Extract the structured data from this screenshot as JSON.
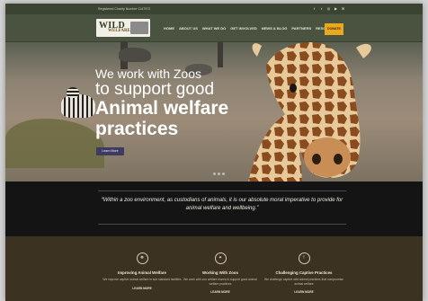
{
  "topbar": {
    "registration": "Registered Charity Number 1147972",
    "social_icons": [
      "facebook-icon",
      "twitter-icon",
      "instagram-icon",
      "youtube-icon",
      "email-icon"
    ]
  },
  "logo": {
    "main": "WILD",
    "sub": "WELFARE"
  },
  "nav": {
    "items": [
      "HOME",
      "ABOUT US",
      "WHAT WE DO",
      "GET INVOLVED",
      "NEWS & BLOG",
      "PARTNERS",
      "RESOURCES"
    ],
    "donate_label": "DONATE"
  },
  "hero": {
    "line1": "We work with Zoos",
    "line2": "to support good",
    "line3": "Animal welfare",
    "line4": "practices",
    "button_label": "Learn More"
  },
  "quote": {
    "text": "“Within a zoo environment, as custodians of animals, it is our absolute moral imperative to provide for animal welfare and wellbeing.”"
  },
  "features": [
    {
      "title": "Improving Animal Welfare",
      "desc": "We improve captive animal welfare in sub standard facilities",
      "more": "LEARN MORE",
      "icon": "paw-icon"
    },
    {
      "title": "Working With Zoos",
      "desc": "We work with zoo welfare teams to support good animal welfare practices",
      "more": "LEARN MORE",
      "icon": "handshake-icon"
    },
    {
      "title": "Challenging Captive Practices",
      "desc": "We challenge captive wild animal practices that compromise animal welfare",
      "more": "LEARN MORE",
      "icon": "alert-icon"
    }
  ],
  "colors": {
    "topbar": "#3b4331",
    "nav": "#4a5340",
    "donate": "#e9a91e",
    "learn_more": "#3d3b61",
    "quote_bg": "#141414",
    "features_bg": "#3b3222"
  }
}
